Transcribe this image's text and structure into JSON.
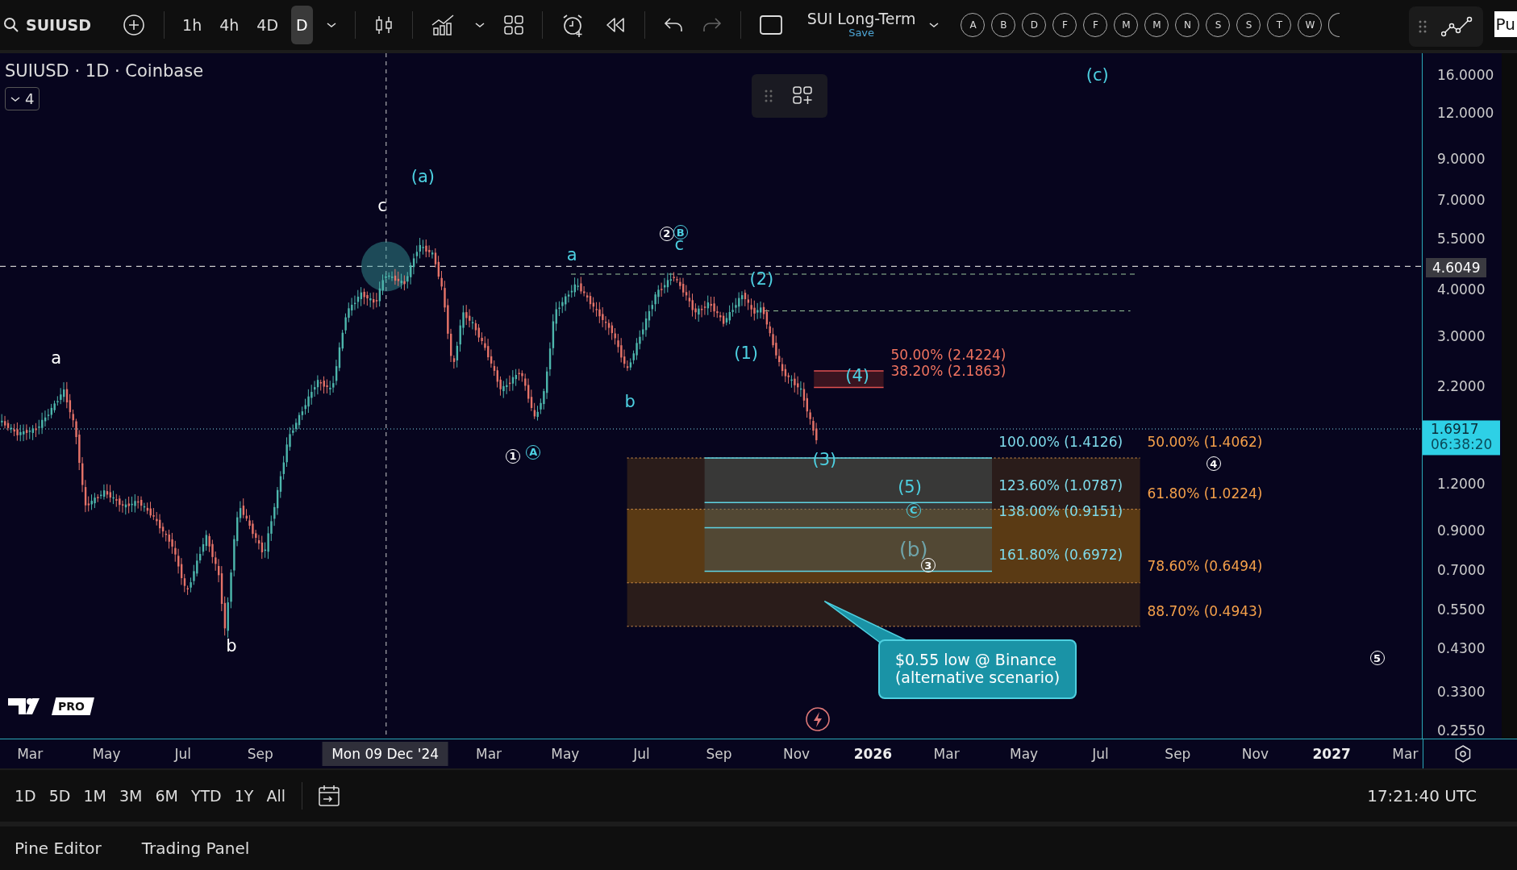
{
  "toolbar": {
    "symbol": "SUIUSD",
    "intervals": [
      {
        "label": "1h",
        "selected": false
      },
      {
        "label": "4h",
        "selected": false
      },
      {
        "label": "4D",
        "selected": false
      },
      {
        "label": "D",
        "selected": true
      }
    ],
    "layout": {
      "name": "SUI Long-Term",
      "status": "Save"
    },
    "watchlist_letters": [
      "A",
      "B",
      "D",
      "F",
      "F",
      "M",
      "M",
      "N",
      "S",
      "S",
      "T",
      "W"
    ],
    "overflow_text": "Pu"
  },
  "legend": {
    "title": "SUIUSD · 1D · Coinbase",
    "collapse_count": "4"
  },
  "wave_labels": [
    {
      "text": "a",
      "kind": "plain",
      "color": "#ffffff"
    },
    {
      "text": "b",
      "kind": "plain",
      "color": "#ffffff"
    },
    {
      "text": "c",
      "kind": "plain",
      "color": "#ffffff"
    },
    {
      "text": "(a)",
      "kind": "plain",
      "color": "#4dd0e1"
    },
    {
      "text": "(c)",
      "kind": "plain",
      "color": "#4dd0e1"
    },
    {
      "text": "a",
      "kind": "plain",
      "color": "#4dd0e1"
    },
    {
      "text": "b",
      "kind": "plain",
      "color": "#4dd0e1"
    },
    {
      "text": "c",
      "kind": "plain",
      "color": "#4dd0e1"
    },
    {
      "text": "(2)",
      "kind": "plain",
      "color": "#4dd0e1"
    },
    {
      "text": "(1)",
      "kind": "plain",
      "color": "#4dd0e1"
    },
    {
      "text": "(4)",
      "kind": "plain",
      "color": "#4dd0e1"
    },
    {
      "text": "(3)",
      "kind": "plain",
      "color": "#4dd0e1"
    },
    {
      "text": "(5)",
      "kind": "plain",
      "color": "#4dd0e1"
    },
    {
      "text": "(b)",
      "kind": "plain",
      "color": "#6fa3a8"
    },
    {
      "text": "1",
      "kind": "circled",
      "color": "#ffffff"
    },
    {
      "text": "A",
      "kind": "circled",
      "color": "#4dd0e1"
    },
    {
      "text": "2",
      "kind": "circled",
      "color": "#ffffff"
    },
    {
      "text": "B",
      "kind": "circled",
      "color": "#4dd0e1"
    },
    {
      "text": "C",
      "kind": "circled",
      "color": "#4dd0e1"
    },
    {
      "text": "3",
      "kind": "circled",
      "color": "#ffffff"
    },
    {
      "text": "4",
      "kind": "circled",
      "color": "#ffffff"
    },
    {
      "text": "5",
      "kind": "circled",
      "color": "#ffffff"
    }
  ],
  "fib_labels": [
    {
      "text": "50.00% (2.4224)",
      "color": "#f0735f"
    },
    {
      "text": "38.20% (2.1863)",
      "color": "#f0735f"
    },
    {
      "text": "100.00% (1.4126)",
      "color": "#7fdcec"
    },
    {
      "text": "123.60% (1.0787)",
      "color": "#7fdcec"
    },
    {
      "text": "138.00% (0.9151)",
      "color": "#7fdcec"
    },
    {
      "text": "161.80% (0.6972)",
      "color": "#7fdcec"
    },
    {
      "text": "50.00% (1.4062)",
      "color": "#f5a04a"
    },
    {
      "text": "61.80% (1.0224)",
      "color": "#f5a04a"
    },
    {
      "text": "78.60% (0.6494)",
      "color": "#f5a04a"
    },
    {
      "text": "88.70% (0.4943)",
      "color": "#f5a04a"
    }
  ],
  "callout": {
    "text": "$0.55 low @ Binance\n(alternative scenario)"
  },
  "logo": {
    "badge": "PRO"
  },
  "price_axis": {
    "ticks": [
      "16.0000",
      "12.0000",
      "9.0000",
      "7.0000",
      "5.5000",
      "4.0000",
      "3.0000",
      "2.2000",
      "1.2000",
      "0.9000",
      "0.7000",
      "0.5500",
      "0.4300",
      "0.3300",
      "0.2550"
    ],
    "last_marker": "4.6049",
    "current_price": "1.6917",
    "countdown": "06:38:20"
  },
  "time_axis": [
    {
      "label": "Mar",
      "kind": "month"
    },
    {
      "label": "May",
      "kind": "month"
    },
    {
      "label": "Jul",
      "kind": "month"
    },
    {
      "label": "Sep",
      "kind": "month"
    },
    {
      "label": "Mon 09 Dec '24",
      "kind": "cursor"
    },
    {
      "label": "Mar",
      "kind": "month"
    },
    {
      "label": "May",
      "kind": "month"
    },
    {
      "label": "Jul",
      "kind": "month"
    },
    {
      "label": "Sep",
      "kind": "month"
    },
    {
      "label": "Nov",
      "kind": "month"
    },
    {
      "label": "2026",
      "kind": "year"
    },
    {
      "label": "Mar",
      "kind": "month"
    },
    {
      "label": "May",
      "kind": "month"
    },
    {
      "label": "Jul",
      "kind": "month"
    },
    {
      "label": "Sep",
      "kind": "month"
    },
    {
      "label": "Nov",
      "kind": "month"
    },
    {
      "label": "2027",
      "kind": "year"
    },
    {
      "label": "Mar",
      "kind": "month"
    }
  ],
  "range_bar": {
    "ranges": [
      "1D",
      "5D",
      "1M",
      "3M",
      "6M",
      "YTD",
      "1Y",
      "All"
    ],
    "clock": "17:21:40 UTC"
  },
  "bottom_panel": {
    "tabs": [
      "Pine Editor",
      "Trading Panel"
    ]
  }
}
